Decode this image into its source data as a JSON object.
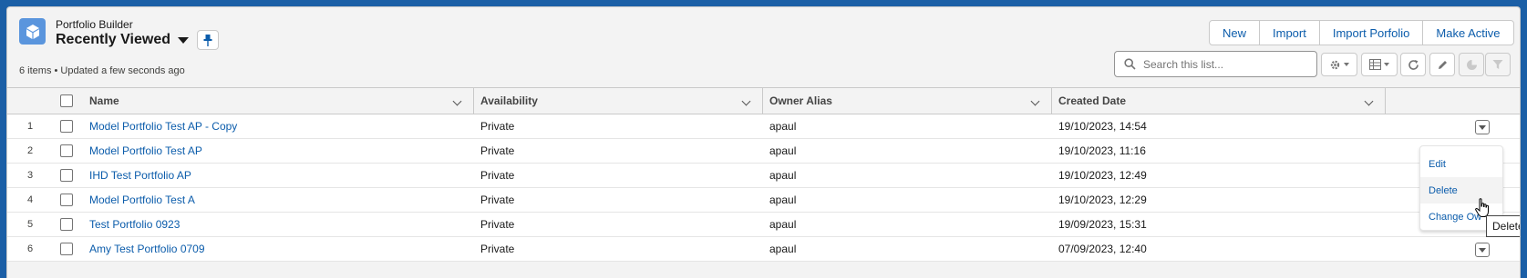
{
  "header": {
    "object_name": "Portfolio Builder",
    "list_view_title": "Recently Viewed",
    "status_text": "6 items • Updated a few seconds ago"
  },
  "actions": {
    "new": "New",
    "import": "Import",
    "import_portfolio": "Import Porfolio",
    "make_active": "Make Active"
  },
  "search": {
    "placeholder": "Search this list..."
  },
  "toolbar_icons": [
    "gear-icon",
    "table-icon",
    "refresh-icon",
    "pencil-icon",
    "chart-icon",
    "filter-icon"
  ],
  "table": {
    "columns": [
      "Name",
      "Availability",
      "Owner Alias",
      "Created Date"
    ],
    "rows": [
      {
        "num": "1",
        "name": "Model Portfolio Test AP - Copy",
        "availability": "Private",
        "owner": "apaul",
        "created": "19/10/2023, 14:54"
      },
      {
        "num": "2",
        "name": "Model Portfolio Test AP",
        "availability": "Private",
        "owner": "apaul",
        "created": "19/10/2023, 11:16"
      },
      {
        "num": "3",
        "name": "IHD Test Portfolio AP",
        "availability": "Private",
        "owner": "apaul",
        "created": "19/10/2023, 12:49"
      },
      {
        "num": "4",
        "name": "Model Portfolio Test A",
        "availability": "Private",
        "owner": "apaul",
        "created": "19/10/2023, 12:29"
      },
      {
        "num": "5",
        "name": "Test Portfolio 0923",
        "availability": "Private",
        "owner": "apaul",
        "created": "19/09/2023, 15:31"
      },
      {
        "num": "6",
        "name": "Amy Test Portfolio 0709",
        "availability": "Private",
        "owner": "apaul",
        "created": "07/09/2023, 12:40"
      }
    ]
  },
  "row_menu": {
    "items": [
      "Edit",
      "Delete",
      "Change Ow"
    ]
  },
  "tooltip": "Delete",
  "colors": {
    "brand": "#1b5fa6",
    "link": "#0b5cab",
    "app_icon": "#5a95dd"
  }
}
